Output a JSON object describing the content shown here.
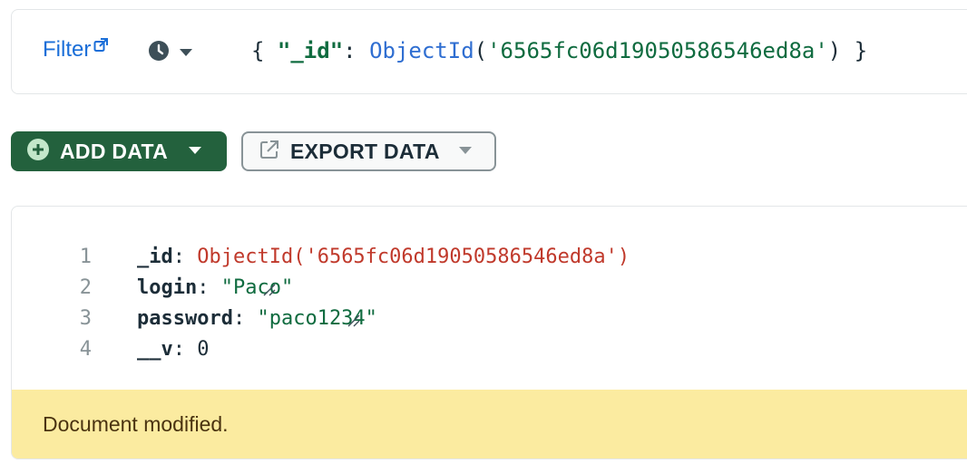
{
  "filter": {
    "label": "Filter",
    "query_open": "{ ",
    "query_key": "\"_id\"",
    "query_colon": ": ",
    "query_fn": "ObjectId",
    "query_paren_open": "(",
    "query_value": "'6565fc06d19050586546ed8a'",
    "query_paren_close": ")",
    "query_close": " }"
  },
  "toolbar": {
    "add_data_label": "ADD DATA",
    "export_data_label": "EXPORT DATA"
  },
  "document": {
    "lines": [
      {
        "num": "1",
        "field": "_id",
        "value": "ObjectId('6565fc06d19050586546ed8a')"
      },
      {
        "num": "2",
        "field": "login",
        "value": "\"Paco\""
      },
      {
        "num": "3",
        "field": "password",
        "value": "\"paco1234\""
      },
      {
        "num": "4",
        "field": "__v",
        "value": "0"
      }
    ],
    "status_message": "Document modified."
  },
  "colors": {
    "accent_green": "#23613d",
    "link_blue": "#1a6ed8",
    "banner_yellow": "#fbeba0"
  },
  "icons": [
    "external-link-icon",
    "clock-icon",
    "caret-down-icon",
    "plus-circle-icon",
    "export-icon",
    "resize-handle-icon"
  ]
}
